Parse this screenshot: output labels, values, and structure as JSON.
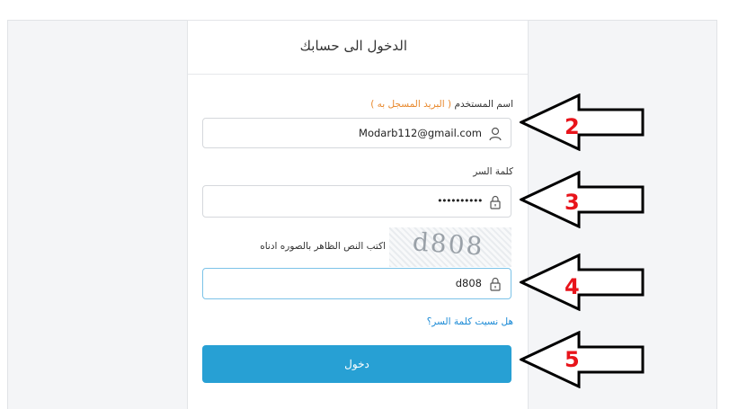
{
  "form": {
    "title": "الدخول الى حسابك",
    "username_label": "اسم المستخدم",
    "username_hint": "( البريد المسجل به )",
    "username_value": "Modarb112@gmail.com",
    "password_label": "كلمة السر",
    "password_value": "••••••••••",
    "captcha_image_text": "d808",
    "captcha_label": "اكتب النص الظاهر بالصوره ادناه",
    "captcha_value": "d808",
    "forgot_link": "هل نسيت كلمة السر؟",
    "login_button": "دخول"
  },
  "annotations": {
    "arrow_color": "#000000",
    "number_color": "#e8141b",
    "labels": [
      "2",
      "3",
      "4",
      "5"
    ]
  },
  "icons": {
    "username": "user-icon",
    "password": "lock-icon",
    "captcha": "lock-icon"
  }
}
